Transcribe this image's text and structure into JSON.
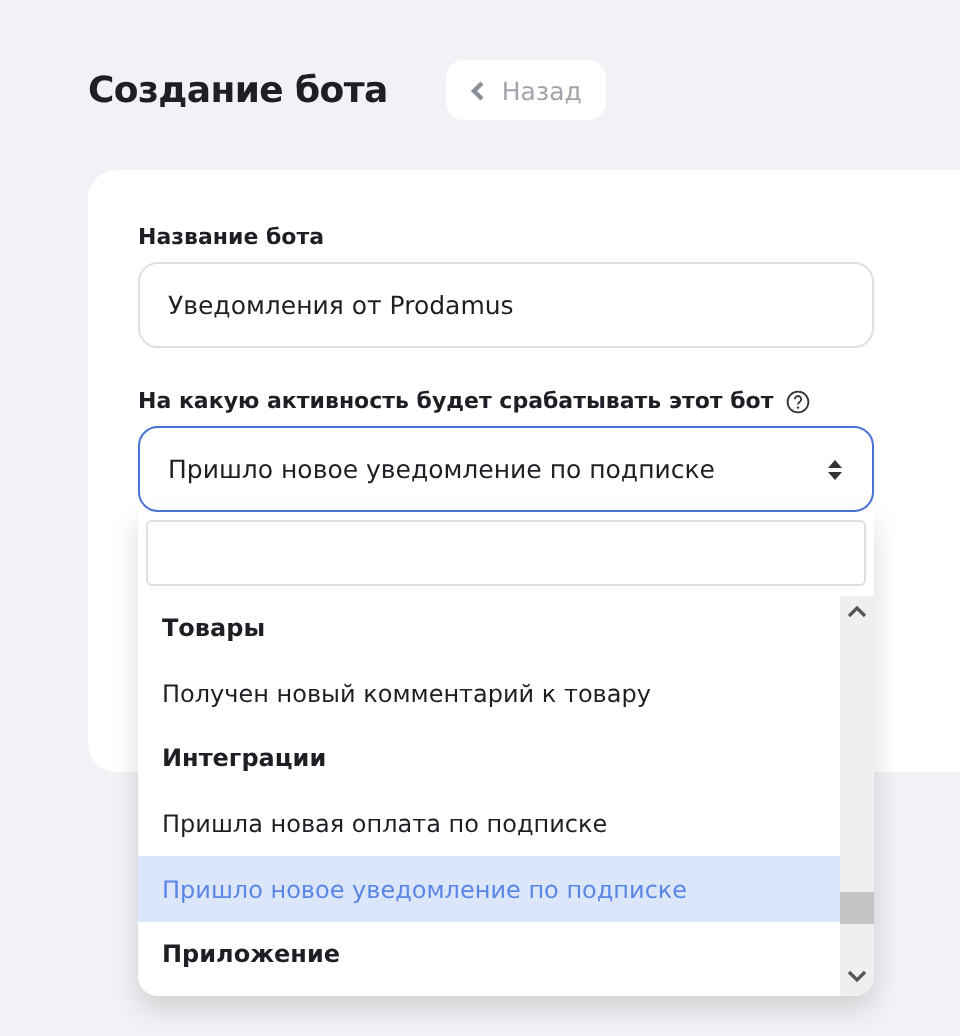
{
  "page": {
    "title": "Создание бота",
    "back_button": "Назад"
  },
  "form": {
    "name_label": "Название бота",
    "name_value": "Уведомления от Prodamus",
    "trigger_label": "На какую активность будет срабатывать этот бот",
    "trigger_value": "Пришло новое уведомление по подписке"
  },
  "dropdown": {
    "expanded": true,
    "items": [
      {
        "kind": "group",
        "label": "Товары"
      },
      {
        "kind": "option",
        "label": "Получен новый комментарий к товару",
        "selected": false
      },
      {
        "kind": "group",
        "label": "Интеграции"
      },
      {
        "kind": "option",
        "label": "Пришла новая оплата по подписке",
        "selected": false
      },
      {
        "kind": "option",
        "label": "Пришло новое уведомление по подписке",
        "selected": true
      },
      {
        "kind": "group",
        "label": "Приложение"
      }
    ]
  }
}
